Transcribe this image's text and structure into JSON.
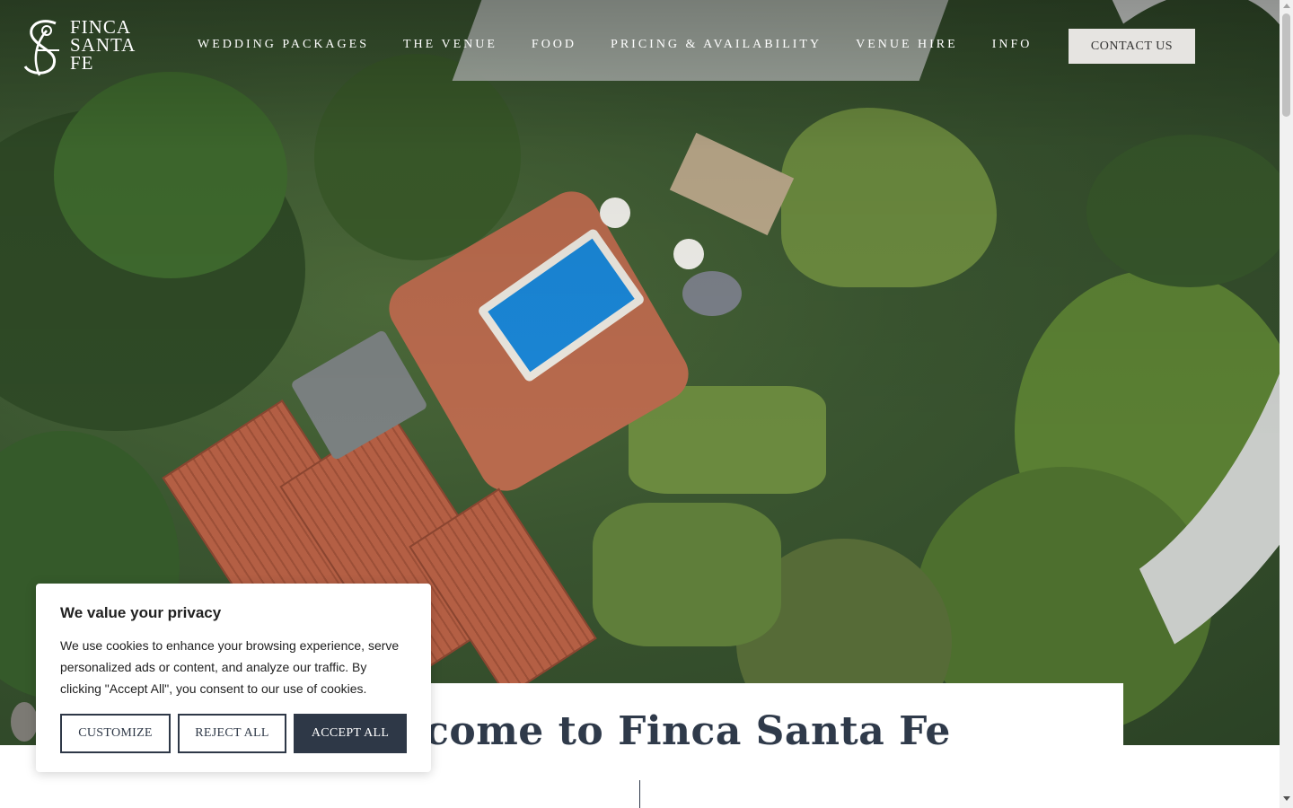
{
  "brand": {
    "logo_lines": [
      "FINCA",
      "SANTA",
      "FE"
    ]
  },
  "nav": {
    "items": [
      {
        "label": "WEDDING PACKAGES"
      },
      {
        "label": "THE VENUE"
      },
      {
        "label": "FOOD"
      },
      {
        "label": "PRICING & AVAILABILITY"
      },
      {
        "label": "VENUE HIRE"
      },
      {
        "label": "INFO"
      }
    ],
    "contact_label": "CONTACT US"
  },
  "hero": {
    "image_icon": "aerial-venue-photo"
  },
  "welcome": {
    "title": "Welcome to Finca Santa Fe"
  },
  "cookie_banner": {
    "title": "We value your privacy",
    "text": "We use cookies to enhance your browsing experience, serve personalized ads or content, and analyze our traffic. By clicking \"Accept All\", you consent to our use of cookies.",
    "buttons": {
      "customize": "CUSTOMIZE",
      "reject": "REJECT ALL",
      "accept": "ACCEPT ALL"
    }
  },
  "colors": {
    "primary_dark": "#2e3847",
    "heading": "#2f3a4a",
    "contact_bg": "#e6e4e1"
  }
}
